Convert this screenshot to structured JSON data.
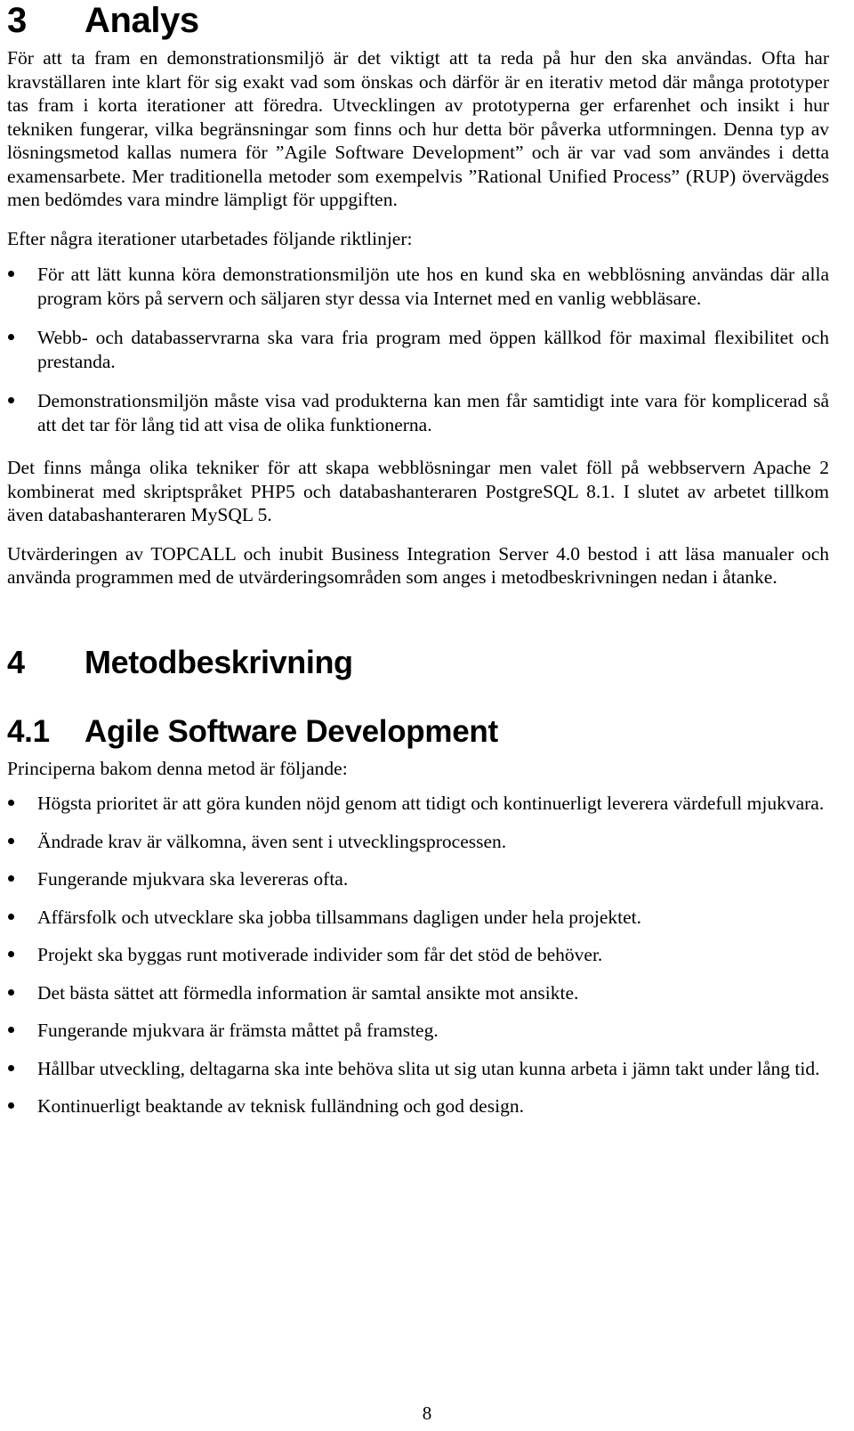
{
  "document": {
    "page_number": "8"
  },
  "section_analys": {
    "number": "3",
    "title": "Analys",
    "paragraphs": [
      "För att ta fram en demonstrationsmiljö är det viktigt att ta reda på hur den ska användas. Ofta har kravställaren inte klart för sig exakt vad som önskas och därför är en iterativ metod där många prototyper tas fram i korta iterationer att föredra. Utvecklingen av prototyperna ger erfarenhet och insikt i hur tekniken fungerar, vilka begränsningar som finns och hur detta bör påverka utformningen. Denna typ av lösningsmetod kallas numera för ”Agile Software Development” och är var vad som användes i detta examensarbete. Mer traditionella metoder som exempelvis ”Rational Unified Process” (RUP) övervägdes men bedömdes vara mindre lämpligt för uppgiften.",
      "Efter några iterationer utarbetades följande riktlinjer:"
    ],
    "guidelines": [
      "För att lätt kunna köra demonstrationsmiljön ute hos en kund ska en webblösning användas där alla program körs på servern och säljaren styr dessa via Internet med en vanlig webbläsare.",
      "Webb- och databasservrarna ska vara fria program med öppen källkod för maximal flexibilitet och prestanda.",
      "Demonstrationsmiljön måste visa vad produkterna kan men får samtidigt inte vara för komplicerad så att det tar för lång tid att visa de olika funktionerna."
    ],
    "closing_paragraphs": [
      "Det finns många olika tekniker för att skapa webblösningar men valet föll på webbservern Apache 2 kombinerat med skriptspråket PHP5 och databashanteraren PostgreSQL 8.1. I slutet av arbetet tillkom även databashanteraren MySQL 5.",
      "Utvärderingen av TOPCALL och inubit Business Integration Server 4.0 bestod i att läsa manualer och använda programmen med de utvärderingsområden som anges i metodbeskrivningen nedan i åtanke."
    ]
  },
  "section_metod": {
    "number": "4",
    "title": "Metodbeskrivning"
  },
  "section_agile": {
    "number": "4.1",
    "title": "Agile Software Development",
    "intro": "Principerna bakom denna metod är följande:",
    "principles": [
      "Högsta prioritet är att göra kunden nöjd genom att tidigt och kontinuerligt leverera värdefull mjukvara.",
      "Ändrade krav är välkomna, även sent i utvecklingsprocessen.",
      "Fungerande mjukvara ska levereras ofta.",
      "Affärsfolk och utvecklare ska jobba tillsammans dagligen under hela projektet.",
      "Projekt ska byggas runt motiverade individer som får det stöd de behöver.",
      "Det bästa sättet att förmedla information är samtal ansikte mot ansikte.",
      "Fungerande mjukvara är främsta måttet på framsteg.",
      "Hållbar utveckling, deltagarna ska inte behöva slita ut sig utan kunna arbeta i jämn takt under lång tid.",
      "Kontinuerligt beaktande av teknisk fulländning och god design."
    ]
  }
}
